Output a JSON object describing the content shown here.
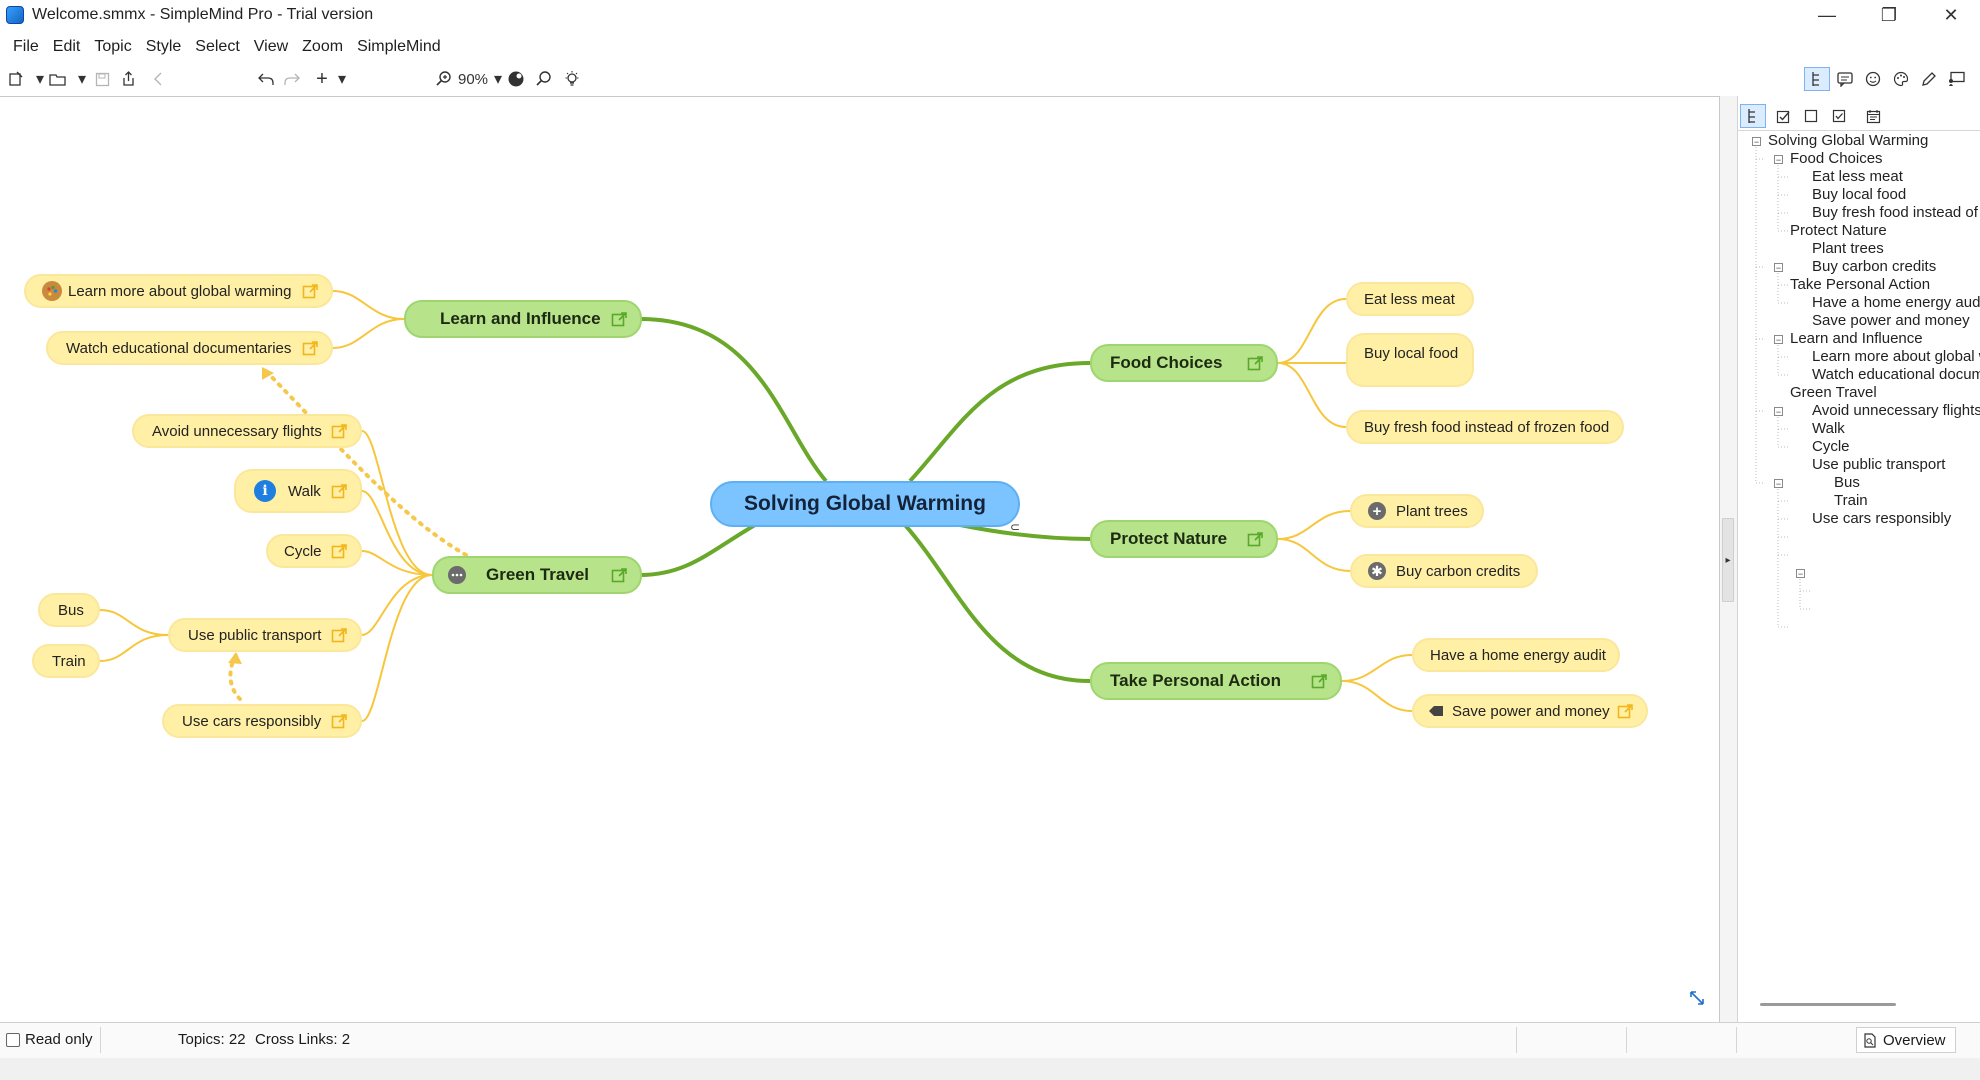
{
  "window": {
    "title": "Welcome.smmx - SimpleMind Pro - Trial version",
    "minimize_glyph": "—",
    "maximize_glyph": "❐",
    "close_glyph": "✕"
  },
  "menu": [
    "File",
    "Edit",
    "Topic",
    "Style",
    "Select",
    "View",
    "Zoom",
    "SimpleMind"
  ],
  "toolbar": {
    "zoom_label": "90%",
    "left_icons": [
      "new-document-icon",
      "open-folder-icon",
      "save-icon",
      "share-icon",
      "back-icon",
      "undo-icon",
      "redo-icon",
      "add-topic-icon",
      "zoom-icon",
      "style-palette-icon",
      "search-icon",
      "idea-bulb-icon"
    ],
    "right_icons": [
      "outline-view-icon",
      "notes-icon",
      "emoji-icon",
      "palette-icon",
      "pen-icon",
      "presentation-icon"
    ]
  },
  "mindmap": {
    "central": "Solving Global Warming",
    "main": {
      "learn": "Learn and Influence",
      "travel": "Green Travel",
      "food": "Food Choices",
      "nature": "Protect Nature",
      "action": "Take Personal Action"
    },
    "leaves": {
      "learn_more": "Learn more about global warming",
      "documentaries": "Watch educational documentaries",
      "flights": "Avoid unnecessary flights",
      "walk": "Walk",
      "cycle": "Cycle",
      "public_transport": "Use public transport",
      "bus": "Bus",
      "train": "Train",
      "cars": "Use cars responsibly",
      "eat_less_meat": "Eat less meat",
      "local_food": "Buy local food",
      "fresh_food": "Buy fresh food instead of frozen food",
      "plant_trees": "Plant trees",
      "carbon_credits": "Buy carbon credits",
      "energy_audit": "Have a home energy audit",
      "save_power": "Save power and money"
    },
    "colors": {
      "central_fill": "#7cc4ff",
      "main_fill": "#b7e38a",
      "leaf_fill": "#fff0a6",
      "main_connector": "#6aa829",
      "leaf_connector": "#f7c63c",
      "crosslink": "#f5c84c"
    }
  },
  "outline": {
    "tabs": [
      "outline-tree-icon",
      "checkbox-list-icon",
      "square-icon",
      "checked-box-icon",
      "calendar-icon"
    ],
    "rows": [
      "Solving Global Warming",
      "Food Choices",
      "Eat less meat",
      "Buy local food",
      "Buy fresh food instead of frozen food",
      "Protect Nature",
      "Plant trees",
      "Buy carbon credits",
      "Take Personal Action",
      "Have a home energy audit",
      "Save power and money",
      "Learn and Influence",
      "Learn more about global warming",
      "Watch educational documentaries",
      "Green Travel",
      "Avoid unnecessary flights",
      "Walk",
      "Cycle",
      "Use public transport",
      "Bus",
      "Train",
      "Use cars responsibly"
    ]
  },
  "status": {
    "read_only_label": "Read only",
    "read_only_checked": false,
    "topics": "Topics: 22",
    "cross_links": "Cross Links: 2",
    "overview_label": "Overview"
  }
}
